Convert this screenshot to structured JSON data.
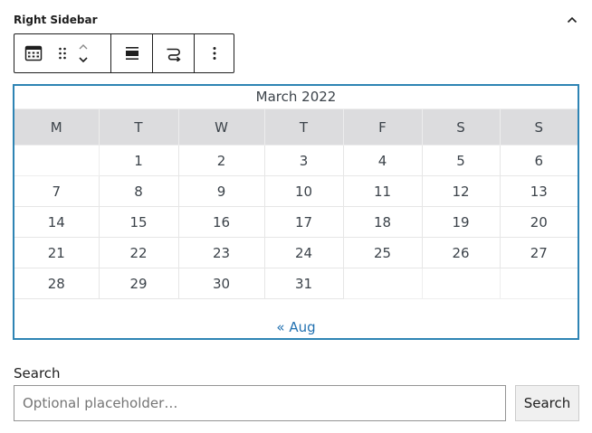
{
  "panel": {
    "title": "Right Sidebar"
  },
  "toolbar": {
    "icons": [
      "calendar-icon",
      "drag-handle-icon",
      "chevron-up-icon",
      "chevron-down-icon",
      "align-icon",
      "transform-icon",
      "more-options-icon"
    ]
  },
  "calendar": {
    "caption": "March 2022",
    "weekdays": [
      "M",
      "T",
      "W",
      "T",
      "F",
      "S",
      "S"
    ],
    "weeks": [
      [
        "",
        "1",
        "2",
        "3",
        "4",
        "5",
        "6"
      ],
      [
        "7",
        "8",
        "9",
        "10",
        "11",
        "12",
        "13"
      ],
      [
        "14",
        "15",
        "16",
        "17",
        "18",
        "19",
        "20"
      ],
      [
        "21",
        "22",
        "23",
        "24",
        "25",
        "26",
        "27"
      ],
      [
        "28",
        "29",
        "30",
        "31",
        "",
        "",
        ""
      ]
    ],
    "prev_link": "« Aug"
  },
  "search": {
    "label": "Search",
    "placeholder": "Optional placeholder…",
    "value": "",
    "button_label": "Search"
  },
  "colors": {
    "accent": "#2e84b4",
    "link": "#2271b1",
    "header_bg": "#dcdcde"
  }
}
